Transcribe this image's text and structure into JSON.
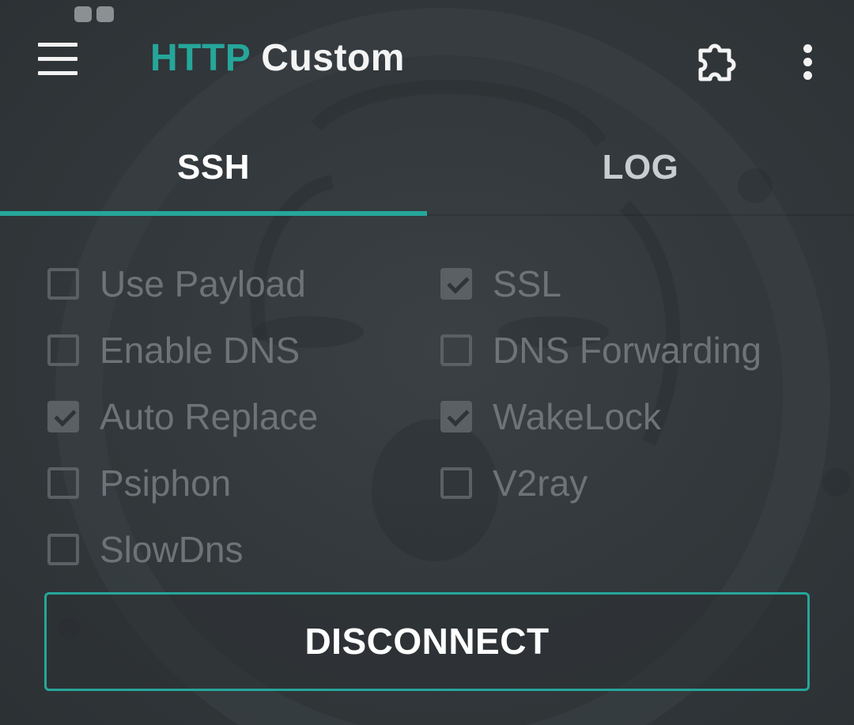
{
  "app_bar": {
    "title_accent": "HTTP",
    "title_rest": "Custom",
    "menu_icon": "hamburger-menu-icon",
    "extension_icon": "puzzle-icon",
    "overflow_icon": "more-vert-icon"
  },
  "tabs": [
    {
      "label": "SSH",
      "selected": true
    },
    {
      "label": "LOG",
      "selected": false
    }
  ],
  "options": {
    "use_payload": {
      "label": "Use Payload",
      "checked": false
    },
    "ssl": {
      "label": "SSL",
      "checked": true
    },
    "enable_dns": {
      "label": "Enable DNS",
      "checked": false
    },
    "dns_forwarding": {
      "label": "DNS Forwarding",
      "checked": false
    },
    "auto_replace": {
      "label": "Auto Replace",
      "checked": true
    },
    "wakelock": {
      "label": "WakeLock",
      "checked": true
    },
    "psiphon": {
      "label": "Psiphon",
      "checked": false
    },
    "v2ray": {
      "label": "V2ray",
      "checked": false
    },
    "slowdns": {
      "label": "SlowDns",
      "checked": false
    }
  },
  "disconnect_label": "DISCONNECT",
  "colors": {
    "accent": "#26a69a",
    "background": "#2f3437",
    "disabled_text": "#6e7377"
  }
}
